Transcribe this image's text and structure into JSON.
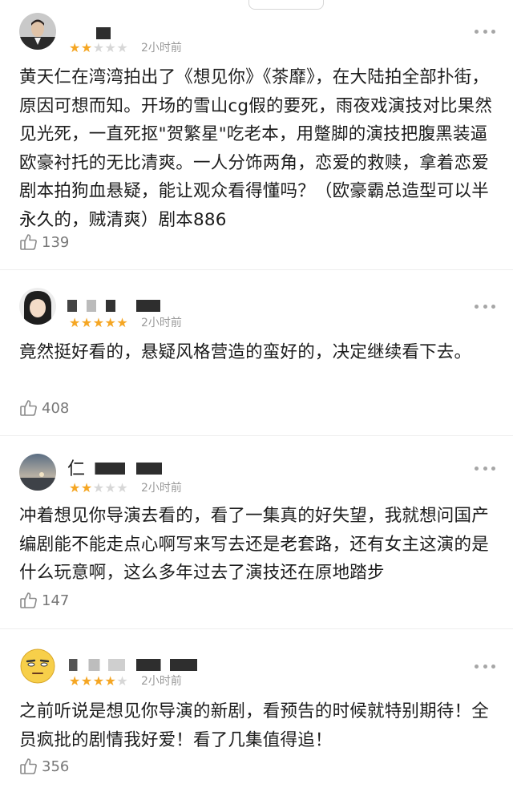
{
  "colors": {
    "star_active": "#f5a623",
    "star_inactive": "#d7d7d7",
    "meta_text": "#9b9b9b"
  },
  "reviews": [
    {
      "rating": 2,
      "max_rating": 5,
      "time": "2小时前",
      "content": "黄天仁在湾湾拍出了《想见你》《茶靡》，在大陆拍全部扑街，原因可想而知。开场的雪山cg假的要死，雨夜戏演技对比果然见光死，一直死抠\"贺繁星\"吃老本，用蹩脚的演技把腹黑装逼欧豪衬托的无比清爽。一人分饰两角，恋爱的救赎，拿着恋爱剧本拍狗血悬疑，能让观众看得懂吗？（欧豪霸总造型可以半永久的，贼清爽）剧本886",
      "likes": "139",
      "avatar_icon": "man-in-suit-avatar",
      "more_icon": "more-dots-icon"
    },
    {
      "rating": 5,
      "max_rating": 5,
      "time": "2小时前",
      "content": "竟然挺好看的，悬疑风格营造的蛮好的，决定继续看下去。",
      "likes": "408",
      "avatar_icon": "girl-avatar",
      "more_icon": "more-dots-icon"
    },
    {
      "rating": 2,
      "max_rating": 5,
      "time": "2小时前",
      "content": "冲着想见你导演去看的，看了一集真的好失望，我就想问国产编剧能不能走点心啊写来写去还是老套路，还有女主这演的是什么玩意啊，这么多年过去了演技还在原地踏步",
      "likes": "147",
      "avatar_icon": "sunset-landscape-avatar",
      "name_partial": "仁",
      "more_icon": "more-dots-icon"
    },
    {
      "rating": 4,
      "max_rating": 5,
      "time": "2小时前",
      "content": "之前听说是想见你导演的新剧，看预告的时候就特别期待！全员疯批的剧情我好爱！看了几集值得追！",
      "likes": "356",
      "avatar_icon": "emoji-face-avatar",
      "more_icon": "more-dots-icon"
    }
  ]
}
